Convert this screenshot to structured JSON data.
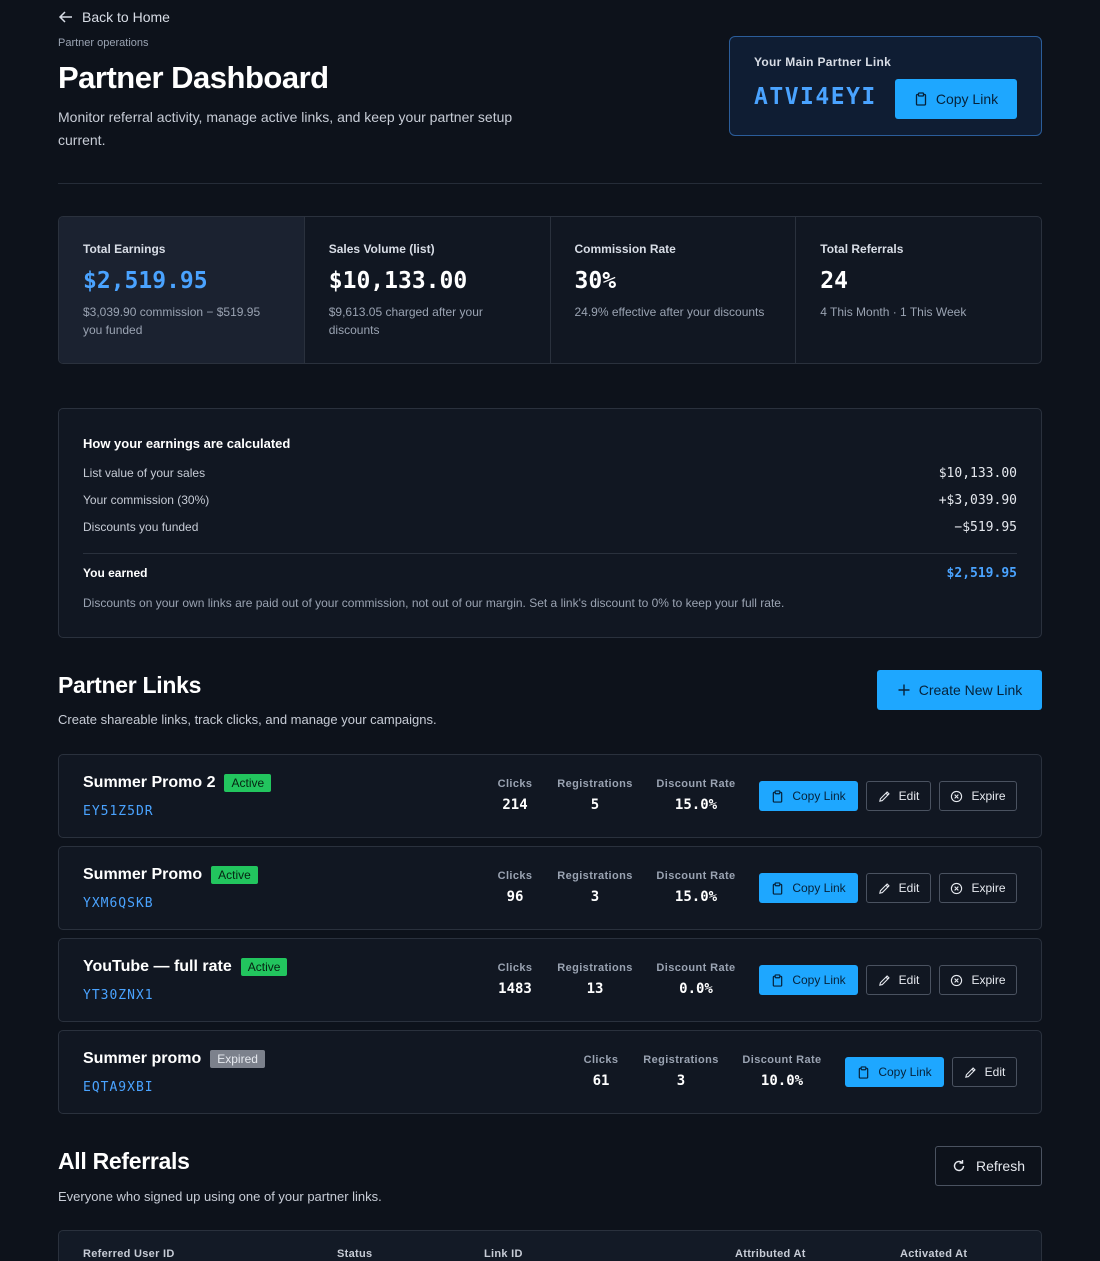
{
  "header": {
    "back_label": "Back to Home",
    "eyebrow": "Partner operations",
    "title": "Partner Dashboard",
    "subtitle": "Monitor referral activity, manage active links, and keep your partner setup current."
  },
  "main_link": {
    "label": "Your Main Partner Link",
    "code": "ATVI4EYI",
    "copy_label": "Copy Link"
  },
  "stats": [
    {
      "label": "Total Earnings",
      "value": "$2,519.95",
      "detail": "$3,039.90 commission − $519.95 you funded"
    },
    {
      "label": "Sales Volume (list)",
      "value": "$10,133.00",
      "detail": "$9,613.05 charged after your discounts"
    },
    {
      "label": "Commission Rate",
      "value": "30%",
      "detail": "24.9% effective after your discounts"
    },
    {
      "label": "Total Referrals",
      "value": "24",
      "detail": "4 This Month · 1 This Week"
    }
  ],
  "calculation": {
    "title": "How your earnings are calculated",
    "rows": [
      {
        "label": "List value of your sales",
        "value": "$10,133.00"
      },
      {
        "label": "Your commission (30%)",
        "value": "+$3,039.90"
      },
      {
        "label": "Discounts you funded",
        "value": "−$519.95"
      }
    ],
    "earned_label": "You earned",
    "earned_value": "$2,519.95",
    "note": "Discounts on your own links are paid out of your commission, not out of our margin. Set a link's discount to 0% to keep your full rate."
  },
  "links_section": {
    "title": "Partner Links",
    "subtitle": "Create shareable links, track clicks, and manage your campaigns.",
    "create_label": "Create New Link",
    "metric_labels": {
      "clicks": "Clicks",
      "registrations": "Registrations",
      "discount": "Discount Rate"
    },
    "copy_label": "Copy Link",
    "edit_label": "Edit",
    "expire_label": "Expire",
    "links": [
      {
        "name": "Summer Promo 2",
        "status": "Active",
        "code": "EY51Z5DR",
        "clicks": "214",
        "registrations": "5",
        "discount": "15.0%"
      },
      {
        "name": "Summer Promo",
        "status": "Active",
        "code": "YXM6QSKB",
        "clicks": "96",
        "registrations": "3",
        "discount": "15.0%"
      },
      {
        "name": "YouTube — full rate",
        "status": "Active",
        "code": "YT30ZNX1",
        "clicks": "1483",
        "registrations": "13",
        "discount": "0.0%"
      },
      {
        "name": "Summer promo",
        "status": "Expired",
        "code": "EQTA9XBI",
        "clicks": "61",
        "registrations": "3",
        "discount": "10.0%"
      }
    ]
  },
  "referrals_section": {
    "title": "All Referrals",
    "subtitle": "Everyone who signed up using one of your partner links.",
    "refresh_label": "Refresh",
    "columns": [
      "Referred User ID",
      "Status",
      "Link ID",
      "Attributed At",
      "Activated At"
    ]
  },
  "colors": {
    "background": "#0d121b",
    "accent": "#1ea7ff",
    "accent_text": "#4aa3ff",
    "active_badge": "#22c55e",
    "expired_badge": "#7c818c"
  }
}
